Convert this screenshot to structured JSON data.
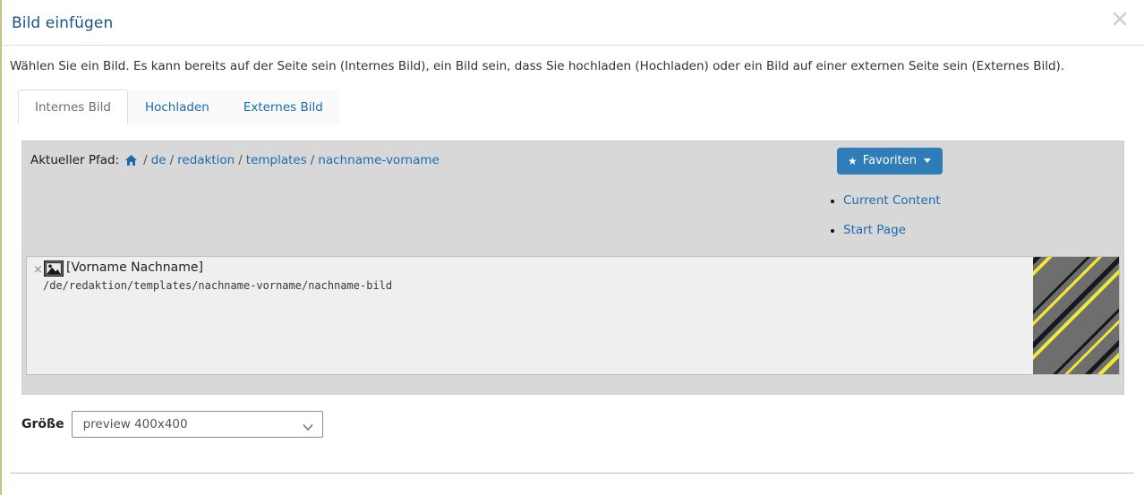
{
  "dialog": {
    "title": "Bild einfügen",
    "close_icon": "close-icon",
    "description": "Wählen Sie ein Bild. Es kann bereits auf der Seite sein (Internes Bild), ein Bild sein, dass Sie hochladen (Hochladen) oder ein Bild auf einer externen Seite sein (Externes Bild)."
  },
  "tabs": [
    {
      "label": "Internes Bild",
      "active": true
    },
    {
      "label": "Hochladen",
      "active": false
    },
    {
      "label": "Externes Bild",
      "active": false
    }
  ],
  "browser": {
    "path_label": "Aktueller Pfad:",
    "home_icon": "home-icon",
    "separator": "/",
    "path_segments": [
      "de",
      "redaktion",
      "templates",
      "nachname-vorname"
    ],
    "favorites_button": {
      "label": "Favoriten",
      "star_icon": "star-icon",
      "caret_icon": "chevron-down-icon"
    },
    "favorites_items": [
      "Current Content",
      "Start Page"
    ]
  },
  "file_list": {
    "remove_mark": "×",
    "image_icon": "image-file-icon",
    "title": "[Vorname Nachname]",
    "path": "/de/redaktion/templates/nachname-vorname/nachname-bild",
    "thumbnail": "striped-diagonal-thumbnail"
  },
  "size": {
    "label": "Größe",
    "selected": "preview 400x400",
    "caret_icon": "chevron-down-icon"
  },
  "colors": {
    "accent_blue": "#1a6bb0",
    "button_blue": "#2e7cb8",
    "title_blue": "#15548a",
    "panel_gray": "#d8d8d8",
    "list_gray": "#efefef",
    "page_border": "#c8c489"
  }
}
